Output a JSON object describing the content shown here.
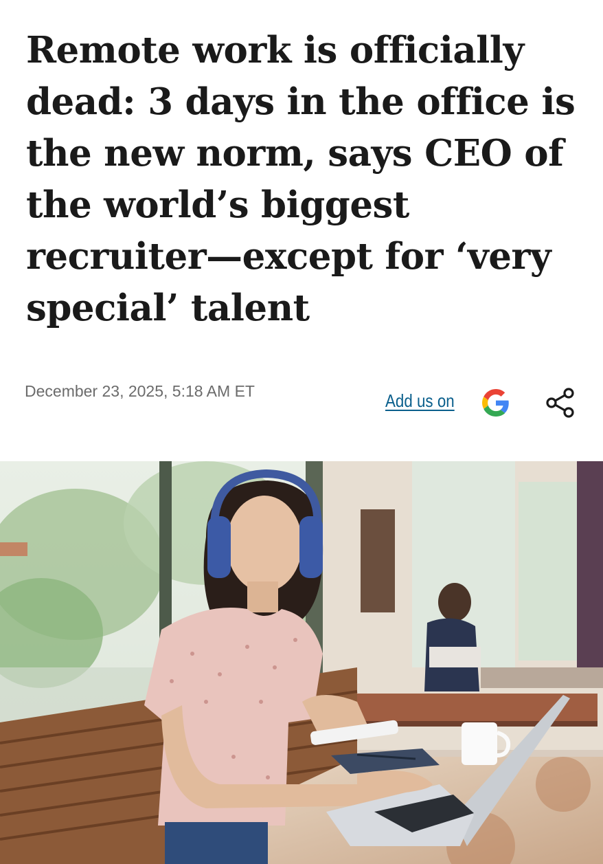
{
  "article": {
    "headline": "Remote work is officially dead: 3 days in the office is the new norm, says CEO of the world’s biggest recruiter—except for ‘very special’ talent",
    "dateline": "December 23, 2025, 5:18 AM ET"
  },
  "actions": {
    "add_us_label": "Add us on",
    "google_icon": "google-g-icon",
    "share_icon": "share-icon"
  },
  "hero_image": {
    "alt": "Woman wearing headphones working on a laptop in a cafe"
  },
  "colors": {
    "headline": "#1a1a1a",
    "meta": "#6b6b6b",
    "link": "#0a5f8c"
  }
}
